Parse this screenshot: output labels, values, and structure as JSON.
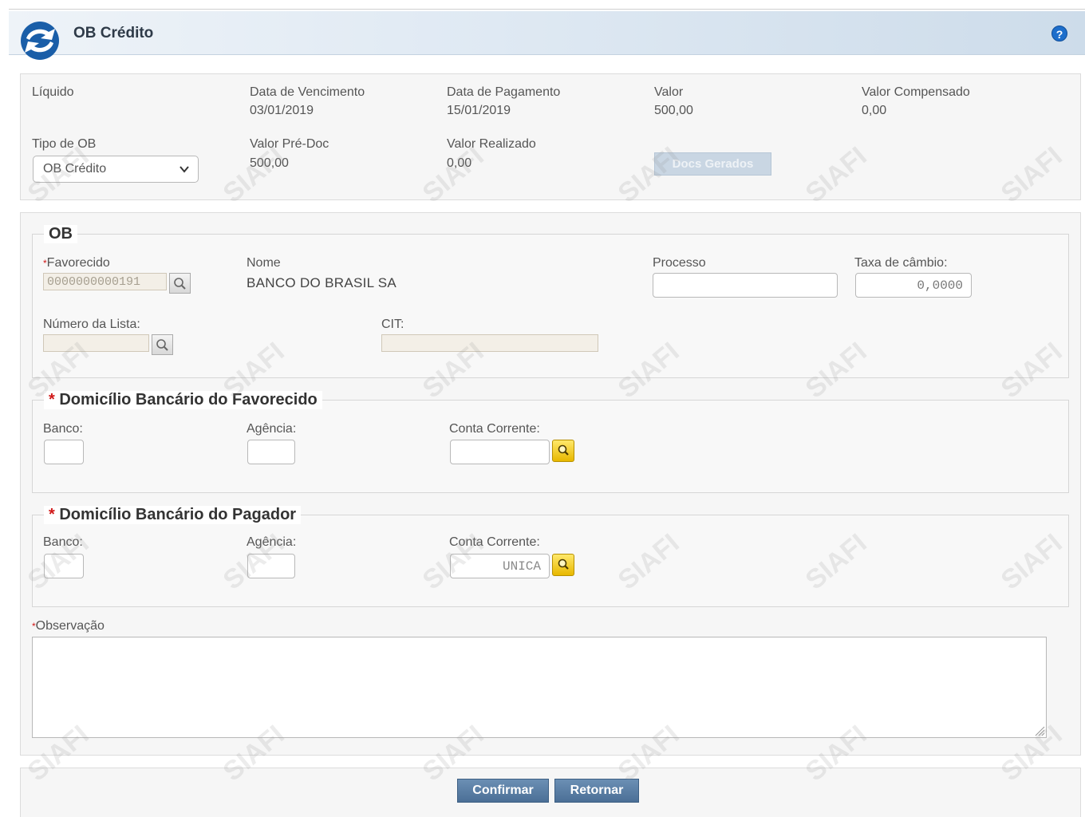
{
  "header": {
    "title": "OB Crédito",
    "help_label": "?"
  },
  "summary": {
    "liquido_label": "Líquido",
    "vencimento_label": "Data de Vencimento",
    "vencimento_value": "03/01/2019",
    "pagamento_label": "Data de Pagamento",
    "pagamento_value": "15/01/2019",
    "valor_label": "Valor",
    "valor_value": "500,00",
    "valor_compensado_label": "Valor Compensado",
    "valor_compensado_value": "0,00",
    "tipo_ob_label": "Tipo de OB",
    "tipo_ob_selected": "OB Crédito",
    "valor_predoc_label": "Valor Pré-Doc",
    "valor_predoc_value": "500,00",
    "valor_realizado_label": "Valor Realizado",
    "valor_realizado_value": "0,00",
    "docs_gerados_label": "Docs Gerados"
  },
  "ob": {
    "legend": "OB",
    "required_mark": "*",
    "favorecido_label": "Favorecido",
    "favorecido_value": "0000000000191",
    "nome_label": "Nome",
    "nome_value": "BANCO DO BRASIL SA",
    "processo_label": "Processo",
    "processo_value": "",
    "taxa_label": "Taxa de câmbio:",
    "taxa_value": "0,0000",
    "numero_lista_label": "Número da Lista:",
    "numero_lista_value": "",
    "cit_label": "CIT:",
    "cit_value": ""
  },
  "domicilio_favorecido": {
    "legend": "Domicílio Bancário do Favorecido",
    "required_mark": "*",
    "banco_label": "Banco:",
    "banco_value": "",
    "agencia_label": "Agência:",
    "agencia_value": "",
    "conta_label": "Conta Corrente:",
    "conta_value": ""
  },
  "domicilio_pagador": {
    "legend": "Domicílio Bancário do Pagador",
    "required_mark": "*",
    "banco_label": "Banco:",
    "banco_value": "",
    "agencia_label": "Agência:",
    "agencia_value": "",
    "conta_label": "Conta Corrente:",
    "conta_value": "UNICA"
  },
  "observacao": {
    "required_mark": "*",
    "label": "Observação",
    "value": ""
  },
  "actions": {
    "confirmar_label": "Confirmar",
    "retornar_label": "Retornar"
  },
  "watermark": {
    "text": "SIAFI"
  },
  "colors": {
    "accent": "#1d6ecb",
    "required": "#d01818",
    "lookup_yellow": "#f2c900",
    "button": "#5a7fa6"
  }
}
